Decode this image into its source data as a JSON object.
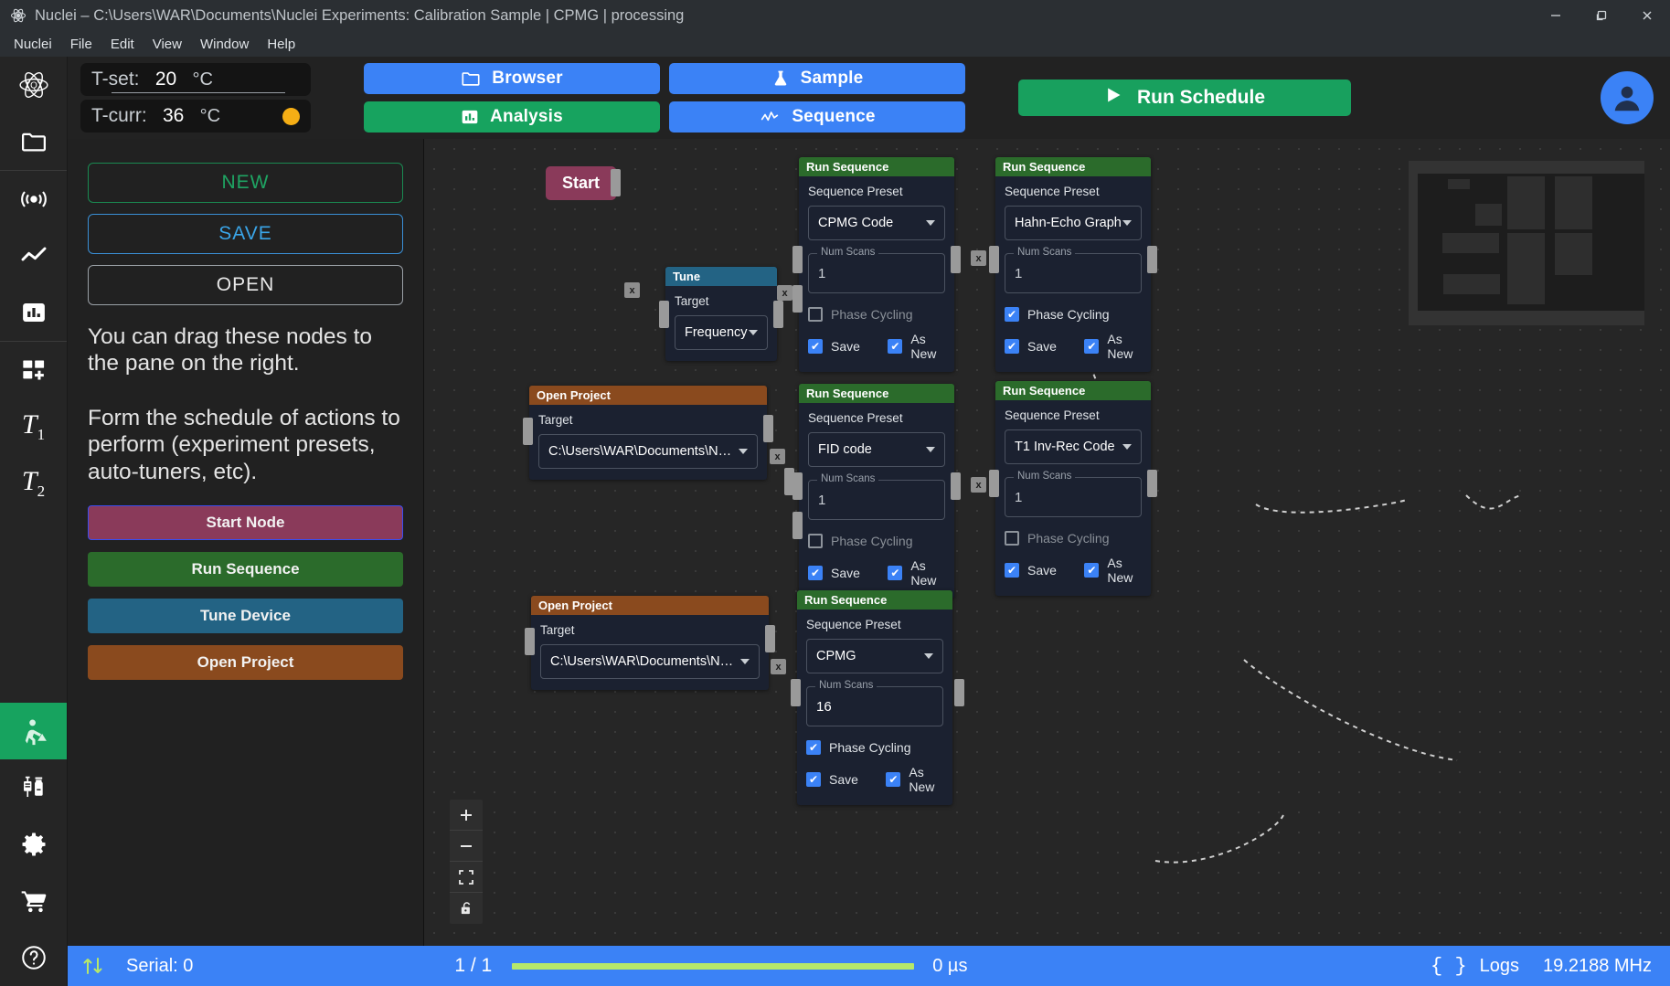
{
  "window": {
    "title": "Nuclei – C:\\Users\\WAR\\Documents\\Nuclei Experiments: Calibration Sample | CPMG | processing",
    "app_icon": "atom-icon",
    "minimize_label": "—",
    "maximize_label": "❐",
    "close_label": "✕"
  },
  "menubar": {
    "items": [
      {
        "label": "Nuclei"
      },
      {
        "label": "File"
      },
      {
        "label": "Edit"
      },
      {
        "label": "View"
      },
      {
        "label": "Window"
      },
      {
        "label": "Help"
      }
    ]
  },
  "rail": {
    "items": [
      {
        "name": "logo-atom-icon",
        "icon": "atom-tqt-icon",
        "active": false
      },
      {
        "name": "folder-icon",
        "icon": "folder-icon",
        "active": false
      },
      {
        "name": "signal-icon",
        "icon": "broadcast-icon",
        "active": false
      },
      {
        "name": "line-chart-icon",
        "icon": "line-chart-icon",
        "active": false
      },
      {
        "name": "bar-chart-icon",
        "icon": "bar-chart-icon",
        "active": false
      },
      {
        "name": "add-panel-icon",
        "icon": "grid-plus-icon",
        "active": false
      },
      {
        "name": "t1-icon",
        "icon": "T1",
        "active": false
      },
      {
        "name": "t2-icon",
        "icon": "T2",
        "active": false
      },
      {
        "name": "schedule-builder-icon",
        "icon": "worker-icon",
        "active": true
      },
      {
        "name": "sample-syringe-icon",
        "icon": "syringe-vial-icon",
        "active": false
      },
      {
        "name": "settings-gear-icon",
        "icon": "gear-icon",
        "active": false
      },
      {
        "name": "cart-icon",
        "icon": "cart-icon",
        "active": false
      },
      {
        "name": "help-icon",
        "icon": "question-circle-icon",
        "active": false
      }
    ]
  },
  "toolbar": {
    "t_set_label": "T-set:",
    "t_set_value": "20",
    "t_set_unit": "°C",
    "t_curr_label": "T-curr:",
    "t_curr_value": "36",
    "t_curr_unit": "°C",
    "status_dot_color": "#f5ae15",
    "buttons": [
      {
        "label": "Browser",
        "icon": "folder-icon",
        "color": "blue"
      },
      {
        "label": "Sample",
        "icon": "flask-icon",
        "color": "blue"
      },
      {
        "label": "Analysis",
        "icon": "bar-chart-icon",
        "color": "green"
      },
      {
        "label": "Sequence",
        "icon": "waveform-icon",
        "color": "blue"
      }
    ],
    "run_schedule_label": "Run Schedule",
    "run_schedule_icon": "play-icon",
    "avatar_icon": "user-avatar-icon"
  },
  "left_panel": {
    "file_buttons": [
      {
        "label": "NEW",
        "style": "new"
      },
      {
        "label": "SAVE",
        "style": "save"
      },
      {
        "label": "OPEN",
        "style": "open"
      }
    ],
    "hint_1": "You can drag these nodes to the pane on the right.",
    "hint_2": "Form the schedule of actions to perform (experiment presets, auto-tuners, etc).",
    "node_buttons": [
      {
        "label": "Start Node",
        "style": "start"
      },
      {
        "label": "Run Sequence",
        "style": "runseq"
      },
      {
        "label": "Tune Device",
        "style": "tune"
      },
      {
        "label": "Open Project",
        "style": "openproj"
      }
    ]
  },
  "canvas": {
    "start_node": {
      "label": "Start"
    },
    "nodes": [
      {
        "id": "tune-1",
        "type": "tune",
        "header": "Tune",
        "field_label": "Target",
        "select_value": "Frequency"
      },
      {
        "id": "openproject-1",
        "type": "open-project",
        "header": "Open Project",
        "field_label": "Target",
        "select_value": "C:\\Users\\WAR\\Documents\\Nuclei Expe..."
      },
      {
        "id": "openproject-2",
        "type": "open-project",
        "header": "Open Project",
        "field_label": "Target",
        "select_value": "C:\\Users\\WAR\\Documents\\Nuclei Expe..."
      },
      {
        "id": "runseq-1",
        "type": "run-sequence",
        "header": "Run Sequence",
        "field_label": "Sequence Preset",
        "select_value": "CPMG Code",
        "num_scans_legend": "Num Scans",
        "num_scans_value": "1",
        "phase_cycling_label": "Phase Cycling",
        "phase_cycling": false,
        "save_label": "Save",
        "save": true,
        "as_new_label": "As New",
        "as_new": true
      },
      {
        "id": "runseq-2",
        "type": "run-sequence",
        "header": "Run Sequence",
        "field_label": "Sequence Preset",
        "select_value": "Hahn-Echo Graph",
        "num_scans_legend": "Num Scans",
        "num_scans_value": "1",
        "phase_cycling_label": "Phase Cycling",
        "phase_cycling": true,
        "save_label": "Save",
        "save": true,
        "as_new_label": "As New",
        "as_new": true
      },
      {
        "id": "runseq-3",
        "type": "run-sequence",
        "header": "Run Sequence",
        "field_label": "Sequence Preset",
        "select_value": "FID code",
        "num_scans_legend": "Num Scans",
        "num_scans_value": "1",
        "phase_cycling_label": "Phase Cycling",
        "phase_cycling": false,
        "save_label": "Save",
        "save": true,
        "as_new_label": "As New",
        "as_new": true
      },
      {
        "id": "runseq-4",
        "type": "run-sequence",
        "header": "Run Sequence",
        "field_label": "Sequence Preset",
        "select_value": "T1 Inv-Rec Code",
        "num_scans_legend": "Num Scans",
        "num_scans_value": "1",
        "phase_cycling_label": "Phase Cycling",
        "phase_cycling": false,
        "save_label": "Save",
        "save": true,
        "as_new_label": "As New",
        "as_new": true
      },
      {
        "id": "runseq-5",
        "type": "run-sequence",
        "header": "Run Sequence",
        "field_label": "Sequence Preset",
        "select_value": "CPMG",
        "num_scans_legend": "Num Scans",
        "num_scans_value": "16",
        "phase_cycling_label": "Phase Cycling",
        "phase_cycling": true,
        "save_label": "Save",
        "save": true,
        "as_new_label": "As New",
        "as_new": true
      }
    ],
    "edge_delete_label": "x",
    "controls": [
      {
        "name": "zoom-in-button",
        "label": "+"
      },
      {
        "name": "zoom-out-button",
        "label": "–"
      },
      {
        "name": "fit-view-button",
        "label": "⛶"
      },
      {
        "name": "lock-toggle-button",
        "label": "🔓"
      }
    ]
  },
  "statusbar": {
    "transfer_icon": "up-down-arrows-icon",
    "serial_label": "Serial: 0",
    "pages_label": "1 / 1",
    "progress_percent": 100,
    "time_label": "0 µs",
    "logs_icon": "braces-icon",
    "logs_label": "Logs",
    "frequency_label": "19.2188 MHz",
    "accent_color": "#3b82f6",
    "progress_color": "#b6e86a"
  }
}
